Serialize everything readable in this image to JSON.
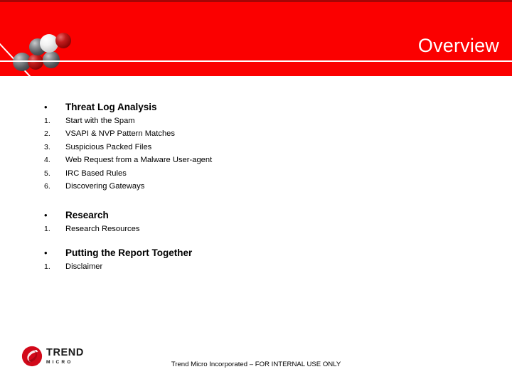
{
  "slide": {
    "title": "Overview",
    "background_color": "#ffffff",
    "banner_color": "#fb0000",
    "banner_accent_color": "#a50505",
    "banner_rule_color": "#ffffff",
    "title_color": "#ffffff"
  },
  "outline": [
    {
      "heading": "Threat Log Analysis",
      "bullet": "•",
      "items": [
        {
          "number": "1.",
          "label": "Start with the Spam"
        },
        {
          "number": "2.",
          "label": "VSAPI & NVP Pattern Matches"
        },
        {
          "number": "3.",
          "label": "Suspicious Packed Files"
        },
        {
          "number": "4.",
          "label": "Web Request from a Malware User-agent"
        },
        {
          "number": "5.",
          "label": "IRC Based Rules"
        },
        {
          "number": "6.",
          "label": "Discovering Gateways"
        }
      ]
    },
    {
      "heading": "Research",
      "bullet": "•",
      "items": [
        {
          "number": "1.",
          "label": "Research Resources"
        }
      ]
    },
    {
      "heading": "Putting the Report Together",
      "bullet": "•",
      "items": [
        {
          "number": "1.",
          "label": "Disclaimer"
        }
      ]
    }
  ],
  "footer": {
    "logo_primary": "TREND",
    "logo_secondary": "MICRO",
    "logo_color": "#d2091a",
    "note": "Trend Micro Incorporated – FOR INTERNAL USE ONLY"
  }
}
